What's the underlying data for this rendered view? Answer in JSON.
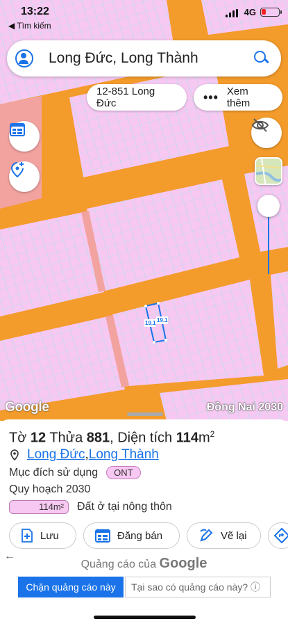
{
  "status": {
    "time": "13:22",
    "back_app": "◀ Tìm kiếm",
    "network": "4G"
  },
  "search": {
    "query": "Long Đức, Long Thành"
  },
  "chips": {
    "lot": "12-851 Long Đức",
    "more": "Xem thêm"
  },
  "map": {
    "google_logo": "Google",
    "layer_label": "Đồng Nai 2030",
    "parcel_dims": [
      "19.1",
      "19.1"
    ],
    "colors": {
      "road": "#f39b2b",
      "residential": "#f7c8f2",
      "public_land": "#f2a3a0",
      "grid_line": "#a6e3e8",
      "accent": "#1a73e8"
    }
  },
  "sheet": {
    "title_prefix": "Tờ ",
    "to_number": "12",
    "thua_label": " Thửa ",
    "thua_number": "881",
    "dien_tich_label": ", Diện tích ",
    "area_value": "114",
    "area_unit": "m",
    "area_exp": "2",
    "location_ward": "Long Đức",
    "location_sep": ", ",
    "location_district": "Long Thành",
    "muc_dich_label": "Mục đích sử dụng",
    "muc_dich_code": "ONT",
    "plan_label": "Quy hoạch 2030",
    "plan_area": "114m²",
    "plan_desc": "Đất ở tại nông thôn"
  },
  "actions": {
    "save": "Lưu",
    "sell": "Đăng bán",
    "redraw": "Vẽ lại"
  },
  "ad": {
    "back": "←",
    "title_prefix": "Quảng cáo của ",
    "title_brand": "Google",
    "block_button": "Chặn quảng cáo này",
    "why_button": "Tại sao có quảng cáo này? ⓘ"
  },
  "icons": [
    "user-icon",
    "search-icon",
    "more-dots-icon",
    "calendar-icon",
    "add-location-icon",
    "visibility-off-icon",
    "layer-thumbnail-icon",
    "location-pin-icon",
    "add-note-icon",
    "calendar-sell-icon",
    "pencil-check-icon",
    "direction-icon"
  ]
}
